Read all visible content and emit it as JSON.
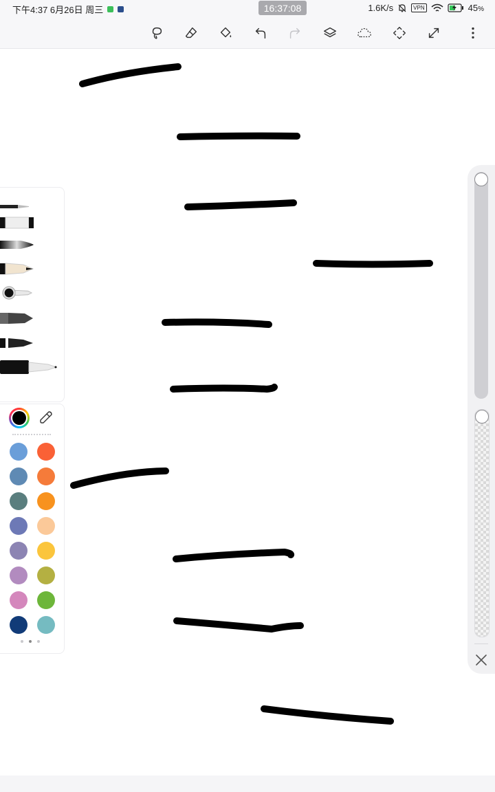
{
  "status_bar": {
    "left_text": "下午4:37 6月26日 周三",
    "clock": "16:37:08",
    "speed": "1.6K/s",
    "vpn": "VPN",
    "battery": "45",
    "battery_unit": "%",
    "icons": [
      "app-icon-green",
      "app-icon-blue",
      "mute-bell-icon",
      "vpn-icon",
      "wifi-icon",
      "battery-charging-icon"
    ]
  },
  "toolbar": {
    "buttons": [
      "lasso-icon",
      "eraser-icon",
      "fill-bucket-icon",
      "undo-icon",
      "redo-icon",
      "layers-icon",
      "selection-icon",
      "transform-icon",
      "fullscreen-icon",
      "more-icon"
    ]
  },
  "brushes": [
    "pencil-brush",
    "flat-brush",
    "ink-brush",
    "charcoal-brush",
    "airbrush",
    "marker-brush",
    "pen-brush",
    "fineliner-brush"
  ],
  "palette": {
    "current_color": "#000000",
    "eyedropper_icon": "eyedropper-icon",
    "swatches": [
      "#6a9ed9",
      "#fa6136",
      "#5f8ab4",
      "#f57b3a",
      "#5a7e7e",
      "#f8921e",
      "#6d79b6",
      "#fbc999",
      "#8c84b3",
      "#fbc53c",
      "#b28bbf",
      "#b4b042",
      "#d487bc",
      "#6db63a",
      "#113b78",
      "#75bbc1"
    ],
    "page_count": 3,
    "active_page": 1
  },
  "sliders": {
    "size_level": 1.0,
    "opacity_level": 1.0,
    "close_icon": "close-icon"
  },
  "strokes_color": "#000000",
  "stroke_count": 10
}
